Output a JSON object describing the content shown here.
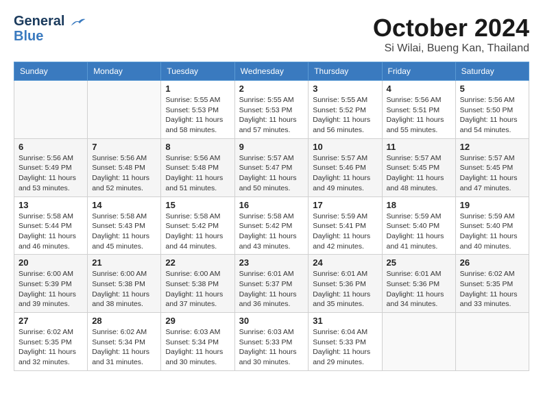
{
  "header": {
    "logo_line1": "General",
    "logo_line2": "Blue",
    "month_title": "October 2024",
    "subtitle": "Si Wilai, Bueng Kan, Thailand"
  },
  "days_of_week": [
    "Sunday",
    "Monday",
    "Tuesday",
    "Wednesday",
    "Thursday",
    "Friday",
    "Saturday"
  ],
  "weeks": [
    [
      {
        "day": "",
        "sunrise": "",
        "sunset": "",
        "daylight": ""
      },
      {
        "day": "",
        "sunrise": "",
        "sunset": "",
        "daylight": ""
      },
      {
        "day": "1",
        "sunrise": "Sunrise: 5:55 AM",
        "sunset": "Sunset: 5:53 PM",
        "daylight": "Daylight: 11 hours and 58 minutes."
      },
      {
        "day": "2",
        "sunrise": "Sunrise: 5:55 AM",
        "sunset": "Sunset: 5:53 PM",
        "daylight": "Daylight: 11 hours and 57 minutes."
      },
      {
        "day": "3",
        "sunrise": "Sunrise: 5:55 AM",
        "sunset": "Sunset: 5:52 PM",
        "daylight": "Daylight: 11 hours and 56 minutes."
      },
      {
        "day": "4",
        "sunrise": "Sunrise: 5:56 AM",
        "sunset": "Sunset: 5:51 PM",
        "daylight": "Daylight: 11 hours and 55 minutes."
      },
      {
        "day": "5",
        "sunrise": "Sunrise: 5:56 AM",
        "sunset": "Sunset: 5:50 PM",
        "daylight": "Daylight: 11 hours and 54 minutes."
      }
    ],
    [
      {
        "day": "6",
        "sunrise": "Sunrise: 5:56 AM",
        "sunset": "Sunset: 5:49 PM",
        "daylight": "Daylight: 11 hours and 53 minutes."
      },
      {
        "day": "7",
        "sunrise": "Sunrise: 5:56 AM",
        "sunset": "Sunset: 5:48 PM",
        "daylight": "Daylight: 11 hours and 52 minutes."
      },
      {
        "day": "8",
        "sunrise": "Sunrise: 5:56 AM",
        "sunset": "Sunset: 5:48 PM",
        "daylight": "Daylight: 11 hours and 51 minutes."
      },
      {
        "day": "9",
        "sunrise": "Sunrise: 5:57 AM",
        "sunset": "Sunset: 5:47 PM",
        "daylight": "Daylight: 11 hours and 50 minutes."
      },
      {
        "day": "10",
        "sunrise": "Sunrise: 5:57 AM",
        "sunset": "Sunset: 5:46 PM",
        "daylight": "Daylight: 11 hours and 49 minutes."
      },
      {
        "day": "11",
        "sunrise": "Sunrise: 5:57 AM",
        "sunset": "Sunset: 5:45 PM",
        "daylight": "Daylight: 11 hours and 48 minutes."
      },
      {
        "day": "12",
        "sunrise": "Sunrise: 5:57 AM",
        "sunset": "Sunset: 5:45 PM",
        "daylight": "Daylight: 11 hours and 47 minutes."
      }
    ],
    [
      {
        "day": "13",
        "sunrise": "Sunrise: 5:58 AM",
        "sunset": "Sunset: 5:44 PM",
        "daylight": "Daylight: 11 hours and 46 minutes."
      },
      {
        "day": "14",
        "sunrise": "Sunrise: 5:58 AM",
        "sunset": "Sunset: 5:43 PM",
        "daylight": "Daylight: 11 hours and 45 minutes."
      },
      {
        "day": "15",
        "sunrise": "Sunrise: 5:58 AM",
        "sunset": "Sunset: 5:42 PM",
        "daylight": "Daylight: 11 hours and 44 minutes."
      },
      {
        "day": "16",
        "sunrise": "Sunrise: 5:58 AM",
        "sunset": "Sunset: 5:42 PM",
        "daylight": "Daylight: 11 hours and 43 minutes."
      },
      {
        "day": "17",
        "sunrise": "Sunrise: 5:59 AM",
        "sunset": "Sunset: 5:41 PM",
        "daylight": "Daylight: 11 hours and 42 minutes."
      },
      {
        "day": "18",
        "sunrise": "Sunrise: 5:59 AM",
        "sunset": "Sunset: 5:40 PM",
        "daylight": "Daylight: 11 hours and 41 minutes."
      },
      {
        "day": "19",
        "sunrise": "Sunrise: 5:59 AM",
        "sunset": "Sunset: 5:40 PM",
        "daylight": "Daylight: 11 hours and 40 minutes."
      }
    ],
    [
      {
        "day": "20",
        "sunrise": "Sunrise: 6:00 AM",
        "sunset": "Sunset: 5:39 PM",
        "daylight": "Daylight: 11 hours and 39 minutes."
      },
      {
        "day": "21",
        "sunrise": "Sunrise: 6:00 AM",
        "sunset": "Sunset: 5:38 PM",
        "daylight": "Daylight: 11 hours and 38 minutes."
      },
      {
        "day": "22",
        "sunrise": "Sunrise: 6:00 AM",
        "sunset": "Sunset: 5:38 PM",
        "daylight": "Daylight: 11 hours and 37 minutes."
      },
      {
        "day": "23",
        "sunrise": "Sunrise: 6:01 AM",
        "sunset": "Sunset: 5:37 PM",
        "daylight": "Daylight: 11 hours and 36 minutes."
      },
      {
        "day": "24",
        "sunrise": "Sunrise: 6:01 AM",
        "sunset": "Sunset: 5:36 PM",
        "daylight": "Daylight: 11 hours and 35 minutes."
      },
      {
        "day": "25",
        "sunrise": "Sunrise: 6:01 AM",
        "sunset": "Sunset: 5:36 PM",
        "daylight": "Daylight: 11 hours and 34 minutes."
      },
      {
        "day": "26",
        "sunrise": "Sunrise: 6:02 AM",
        "sunset": "Sunset: 5:35 PM",
        "daylight": "Daylight: 11 hours and 33 minutes."
      }
    ],
    [
      {
        "day": "27",
        "sunrise": "Sunrise: 6:02 AM",
        "sunset": "Sunset: 5:35 PM",
        "daylight": "Daylight: 11 hours and 32 minutes."
      },
      {
        "day": "28",
        "sunrise": "Sunrise: 6:02 AM",
        "sunset": "Sunset: 5:34 PM",
        "daylight": "Daylight: 11 hours and 31 minutes."
      },
      {
        "day": "29",
        "sunrise": "Sunrise: 6:03 AM",
        "sunset": "Sunset: 5:34 PM",
        "daylight": "Daylight: 11 hours and 30 minutes."
      },
      {
        "day": "30",
        "sunrise": "Sunrise: 6:03 AM",
        "sunset": "Sunset: 5:33 PM",
        "daylight": "Daylight: 11 hours and 30 minutes."
      },
      {
        "day": "31",
        "sunrise": "Sunrise: 6:04 AM",
        "sunset": "Sunset: 5:33 PM",
        "daylight": "Daylight: 11 hours and 29 minutes."
      },
      {
        "day": "",
        "sunrise": "",
        "sunset": "",
        "daylight": ""
      },
      {
        "day": "",
        "sunrise": "",
        "sunset": "",
        "daylight": ""
      }
    ]
  ]
}
